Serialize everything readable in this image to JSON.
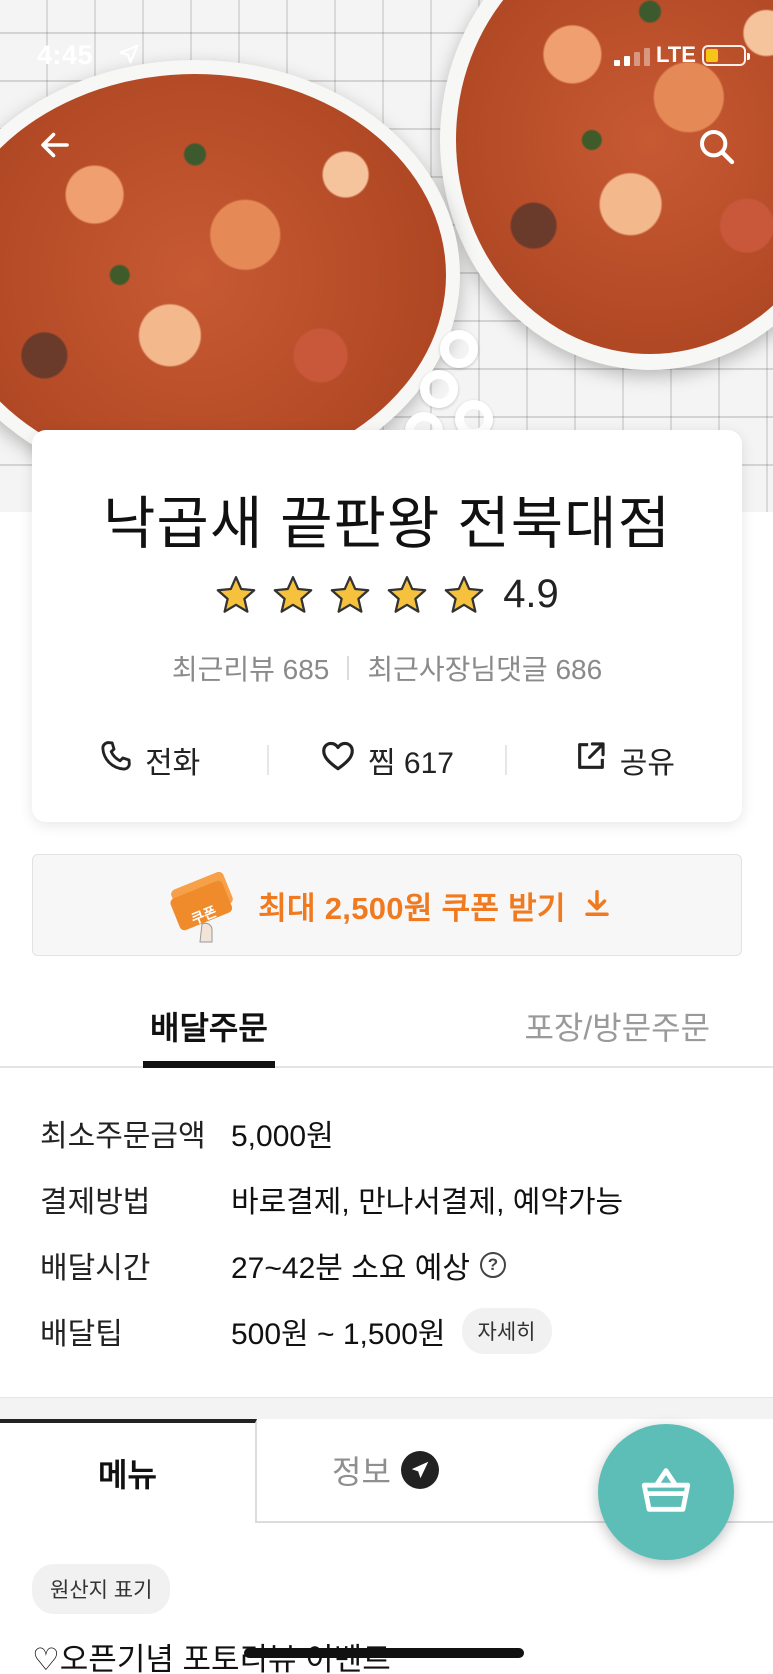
{
  "status_bar": {
    "time": "4:45",
    "network": "LTE"
  },
  "store": {
    "name": "낙곱새 끝판왕 전북대점",
    "rating": "4.9",
    "stars": 5,
    "recent_reviews_label": "최근리뷰 685",
    "recent_owner_replies_label": "최근사장님댓글 686",
    "call_label": "전화",
    "like_label": "찜 617",
    "share_label": "공유"
  },
  "coupon": {
    "badge_text": "쿠폰",
    "label": "최대 2,500원 쿠폰 받기"
  },
  "order_tabs": {
    "delivery": "배달주문",
    "pickup": "포장/방문주문"
  },
  "info": {
    "min_order": {
      "key": "최소주문금액",
      "value": "5,000원"
    },
    "payment": {
      "key": "결제방법",
      "value": "바로결제, 만나서결제, 예약가능"
    },
    "delivery_time": {
      "key": "배달시간",
      "value": "27~42분 소요 예상"
    },
    "delivery_tip": {
      "key": "배달팁",
      "value": "500원 ~ 1,500원",
      "detail_button": "자세히"
    }
  },
  "menu_tabs": {
    "menu": "메뉴",
    "info": "정보"
  },
  "origin_label": "원산지 표기",
  "promo_text": "♡오픈기념 포토리뷰 이벤트",
  "colors": {
    "accent_orange": "#f07a1f",
    "cart_teal": "#5dbdb7",
    "star": "#f6c23e"
  },
  "icons": [
    "back-arrow-icon",
    "search-icon",
    "star-icon",
    "phone-icon",
    "heart-icon",
    "share-icon",
    "download-arrow-icon",
    "help-circle-icon",
    "send-icon",
    "basket-icon"
  ]
}
